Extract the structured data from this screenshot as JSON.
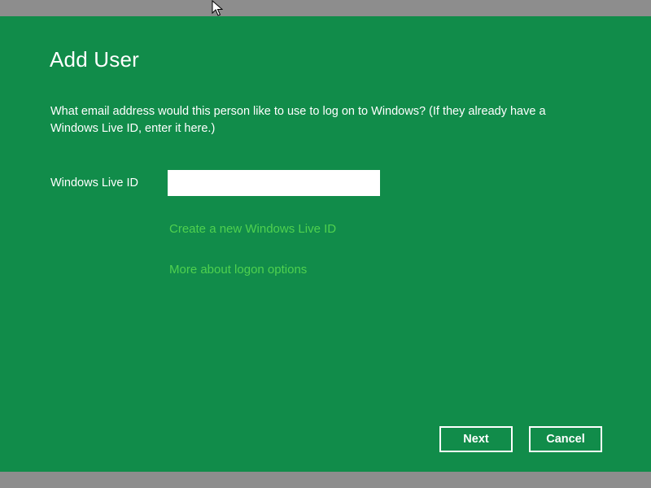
{
  "dialog": {
    "title": "Add User",
    "prompt": "What email address would this person like to use to log on to Windows? (If they already have a Windows Live ID, enter it here.)",
    "field": {
      "label": "Windows Live ID",
      "value": ""
    },
    "links": {
      "create": "Create a new Windows Live ID",
      "more": "More about logon options"
    },
    "buttons": {
      "next": "Next",
      "cancel": "Cancel"
    }
  },
  "colors": {
    "background": "#118c4a",
    "link": "#4fd14f",
    "frame": "#8d8d8d"
  },
  "icons": {
    "cursor": "mouse-pointer-icon"
  }
}
